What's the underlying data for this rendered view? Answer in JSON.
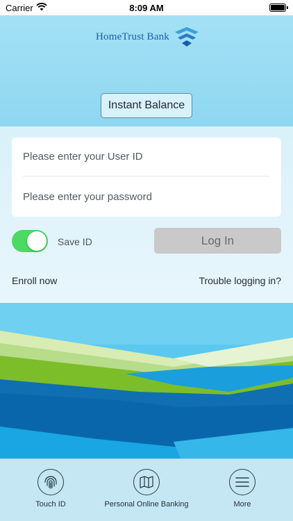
{
  "status_bar": {
    "carrier": "Carrier",
    "time": "8:09 AM"
  },
  "header": {
    "logo_text": "HomeTrust Bank",
    "instant_balance_label": "Instant Balance"
  },
  "login": {
    "user_id_placeholder": "Please enter your User ID",
    "password_placeholder": "Please enter your password",
    "save_id_label": "Save ID",
    "save_id_enabled": true,
    "login_button_label": "Log In",
    "enroll_label": "Enroll now",
    "trouble_label": "Trouble logging in?"
  },
  "tab_bar": {
    "items": [
      {
        "label": "Touch ID",
        "icon": "fingerprint-icon"
      },
      {
        "label": "Personal Online Banking",
        "icon": "map-icon"
      },
      {
        "label": "More",
        "icon": "menu-icon"
      }
    ]
  },
  "colors": {
    "brand_blue": "#1a5ea8",
    "header_sky": "#8fd7f1",
    "toggle_on": "#4cd964",
    "login_disabled": "#c9c9c9"
  }
}
